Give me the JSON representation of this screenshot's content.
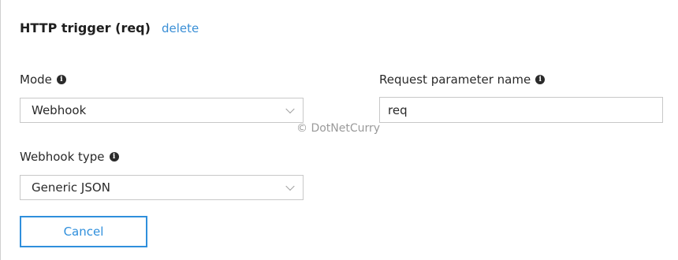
{
  "header": {
    "title": "HTTP trigger (req)",
    "delete_label": "delete"
  },
  "mode": {
    "label": "Mode",
    "value": "Webhook"
  },
  "request_parameter": {
    "label": "Request parameter name",
    "value": "req"
  },
  "webhook_type": {
    "label": "Webhook type",
    "value": "Generic JSON"
  },
  "watermark": "© DotNetCurry",
  "actions": {
    "cancel_label": "Cancel"
  },
  "colors": {
    "accent": "#2f8fdc",
    "link": "#3a8fd6",
    "border": "#c8c8c8"
  },
  "icons": {
    "info": "info-icon",
    "dropdown": "chevron-down-icon"
  }
}
